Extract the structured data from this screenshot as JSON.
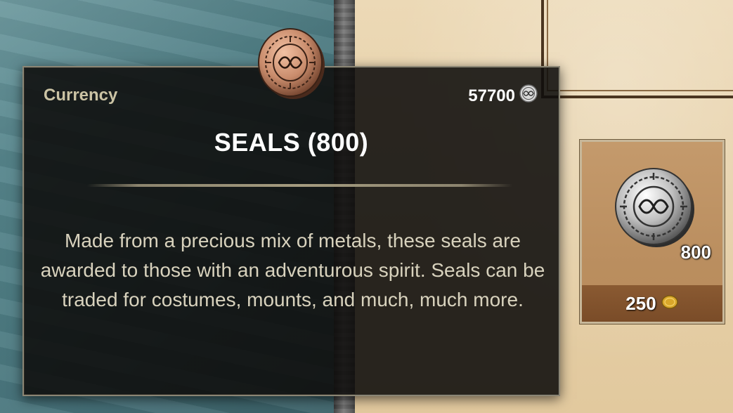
{
  "tooltip": {
    "category": "Currency",
    "balance": "57700",
    "balance_icon": "seal-currency-icon",
    "title": "SEALS (800)",
    "description": "Made from a precious mix of metals, these seals are awarded to those with an adventurous spirit. Seals can be traded for costumes, mounts, and much, much more.",
    "icon": "seal-coin-icon"
  },
  "store_item": {
    "icon": "seal-coin-icon",
    "quantity": "800",
    "price": "250",
    "price_icon": "gold-coin-icon"
  },
  "colors": {
    "tooltip_bg": "#0e0d0b",
    "tooltip_border": "#8b8675",
    "category_text": "#cbc3a4",
    "description_text": "#d8d2bd",
    "card_bg": "#c49a6c",
    "price_bar": "#7a4c28"
  }
}
